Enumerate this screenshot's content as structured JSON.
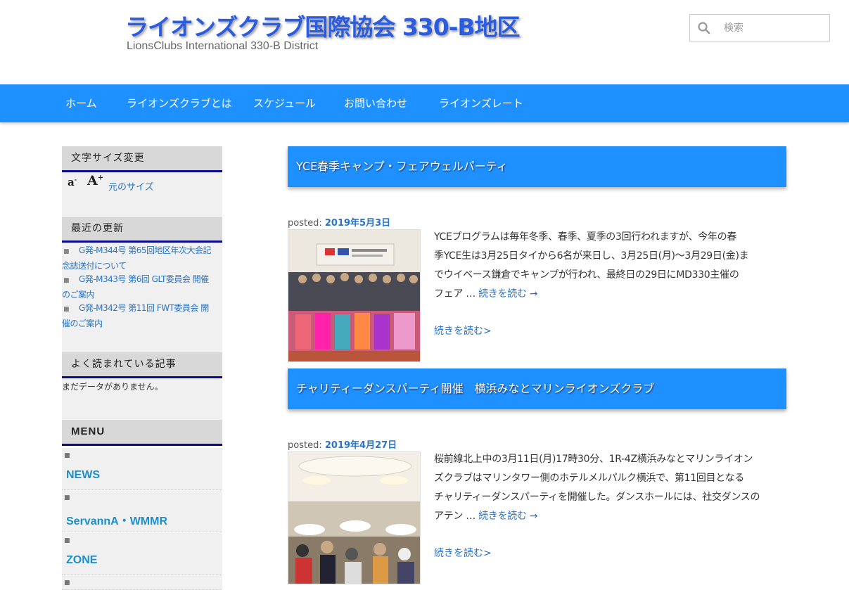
{
  "header": {
    "title": "ライオンズクラブ国際協会 330-B地区",
    "description": "LionsClubs International 330-B District",
    "search_placeholder": "検索"
  },
  "nav": {
    "items": [
      "ホーム",
      "ライオンズクラブとは",
      "スケジュール",
      "お問い合わせ",
      "ライオンズレート"
    ]
  },
  "sidebar": {
    "font_size": {
      "title": "文字サイズ変更",
      "small_label": "a-",
      "large_label": "A+",
      "reset_label": "元のサイズ"
    },
    "recent": {
      "title": "最近の更新",
      "items": [
        {
          "line1": "G発-M344号 第65回地区年次大会記",
          "line2": "念誌送付について"
        },
        {
          "line1": "G発-M343号 第6回 GLT委員会 開催",
          "line2": "のご案内"
        },
        {
          "line1": "G発-M342号 第11回 FWT委員会 開",
          "line2": "催のご案内"
        }
      ]
    },
    "popular": {
      "title": "よく読まれている記事",
      "empty_text": "まだデータがありません。"
    },
    "menu": {
      "title": "MENU",
      "items": [
        "NEWS",
        "ServannA・WMMR",
        "ZONE"
      ]
    }
  },
  "posts": [
    {
      "title": "YCE春季キャンプ・フェアウェルパーティ",
      "posted_label": "posted:",
      "date": "2019年5月3日",
      "excerpt_lines": [
        "YCEプログラムは毎年冬季、春季、夏季の3回行われますが、今年の春",
        "季YCE生は3月25日タイから6名が来日し、3月25日(月)～3月29日(金)ま",
        "でウイベース鎌倉でキャンプが行われ、最終日の29日にMD330主催の",
        "フェア …"
      ],
      "continue_link": "続きを読む →",
      "read_more": "続きを読む>"
    },
    {
      "title": "チャリティーダンスパーティ開催　横浜みなとマリンライオンズクラブ",
      "posted_label": "posted:",
      "date": "2019年4月27日",
      "excerpt_lines": [
        "桜前線北上中の3月11日(月)17時30分、1R-4Z横浜みなとマリンライオン",
        "ズクラブはマリンタワー側のホテルメルパルク横浜で、第11回目となる",
        "チャリティーダンスパーティを開催した。ダンスホールには、社交ダンスの",
        "アテン …"
      ],
      "continue_link": "続きを読む →",
      "read_more": "続きを読む>"
    }
  ]
}
